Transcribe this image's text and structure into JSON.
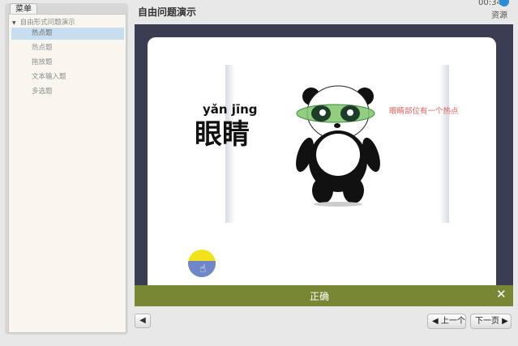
{
  "sidebar": {
    "tab_label": "菜单",
    "root_label": "自由形式问题演示",
    "items": [
      {
        "label": "热点题",
        "active": true
      },
      {
        "label": "热点题",
        "active": false
      },
      {
        "label": "拖放题",
        "active": false
      },
      {
        "label": "文本输入题",
        "active": false
      },
      {
        "label": "多选题",
        "active": false
      }
    ]
  },
  "header": {
    "title": "自由问题演示",
    "timer": "00:34",
    "resources_label": "资源"
  },
  "slide": {
    "pinyin": "yǎn  jīng",
    "hanzi": "眼睛",
    "hotspot_label": "眼睛部位有一个热点"
  },
  "feedback": {
    "text": "正确",
    "close_symbol": "✕"
  },
  "controls": {
    "audio_symbol": "◀",
    "prev_label": "◀ 上一个",
    "next_label": "下一页 ▶"
  },
  "colors": {
    "stage": "#3b3e53",
    "feedback_bar": "#788733",
    "active_item": "#c6def0",
    "hotspot": "#7fc46a"
  }
}
